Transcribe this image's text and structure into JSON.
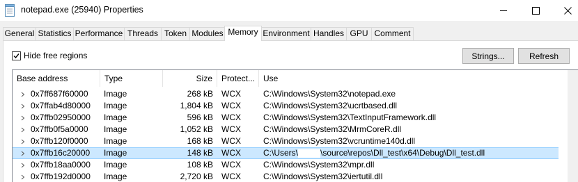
{
  "window": {
    "title": "notepad.exe (25940) Properties",
    "icon": "notepad-icon",
    "controls": [
      "minimize-icon",
      "maximize-icon",
      "close-icon"
    ]
  },
  "tabs": [
    {
      "label": "General"
    },
    {
      "label": "Statistics"
    },
    {
      "label": "Performance"
    },
    {
      "label": "Threads"
    },
    {
      "label": "Token"
    },
    {
      "label": "Modules"
    },
    {
      "label": "Memory",
      "active": true
    },
    {
      "label": "Environment"
    },
    {
      "label": "Handles"
    },
    {
      "label": "GPU"
    },
    {
      "label": "Comment"
    }
  ],
  "memory": {
    "hide_free_label": "Hide free regions",
    "hide_free_checked": true,
    "strings_button": "Strings...",
    "refresh_button": "Refresh",
    "columns": [
      "Base address",
      "Type",
      "Size",
      "Protect...",
      "Use"
    ],
    "rows": [
      {
        "address": "0x7ff687f60000",
        "type": "Image",
        "size": "268 kB",
        "protect": "WCX",
        "use": "C:\\Windows\\System32\\notepad.exe"
      },
      {
        "address": "0x7ffab4d80000",
        "type": "Image",
        "size": "1,804 kB",
        "protect": "WCX",
        "use": "C:\\Windows\\System32\\ucrtbased.dll"
      },
      {
        "address": "0x7ffb02950000",
        "type": "Image",
        "size": "596 kB",
        "protect": "WCX",
        "use": "C:\\Windows\\System32\\TextInputFramework.dll"
      },
      {
        "address": "0x7ffb0f5a0000",
        "type": "Image",
        "size": "1,052 kB",
        "protect": "WCX",
        "use": "C:\\Windows\\System32\\MrmCoreR.dll"
      },
      {
        "address": "0x7ffb120f0000",
        "type": "Image",
        "size": "168 kB",
        "protect": "WCX",
        "use": "C:\\Windows\\System32\\vcruntime140d.dll"
      },
      {
        "address": "0x7ffb16c20000",
        "type": "Image",
        "size": "148 kB",
        "protect": "WCX",
        "use_prefix": "C:\\Users\\",
        "use_suffix": "\\source\\repos\\Dll_test\\x64\\Debug\\Dll_test.dll",
        "selected": true
      },
      {
        "address": "0x7ffb18aa0000",
        "type": "Image",
        "size": "108 kB",
        "protect": "WCX",
        "use": "C:\\Windows\\System32\\mpr.dll"
      },
      {
        "address": "0x7ffb192d0000",
        "type": "Image",
        "size": "2,720 kB",
        "protect": "WCX",
        "use": "C:\\Windows\\System32\\iertutil.dll"
      }
    ]
  },
  "colors": {
    "selection": "#cce8ff",
    "selection_border": "#99d1ff",
    "dialog_bg": "#f0f0f0",
    "button_bg": "#e1e1e1"
  }
}
